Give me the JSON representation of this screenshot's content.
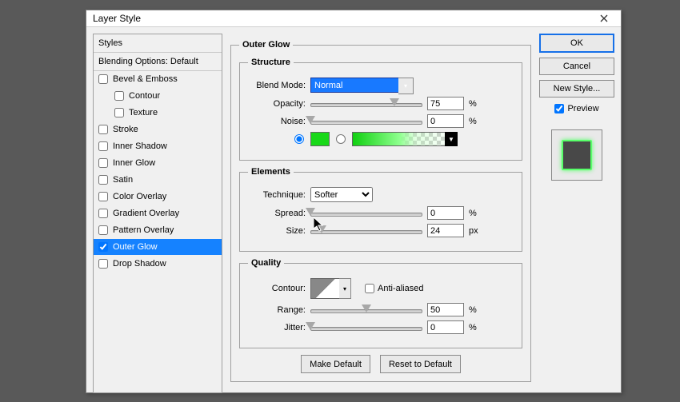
{
  "window": {
    "title": "Layer Style"
  },
  "styles": {
    "header": "Styles",
    "blending": "Blending Options: Default",
    "items": [
      {
        "label": "Bevel & Emboss",
        "indent": false,
        "checked": false,
        "selected": false
      },
      {
        "label": "Contour",
        "indent": true,
        "checked": false,
        "selected": false
      },
      {
        "label": "Texture",
        "indent": true,
        "checked": false,
        "selected": false
      },
      {
        "label": "Stroke",
        "indent": false,
        "checked": false,
        "selected": false
      },
      {
        "label": "Inner Shadow",
        "indent": false,
        "checked": false,
        "selected": false
      },
      {
        "label": "Inner Glow",
        "indent": false,
        "checked": false,
        "selected": false
      },
      {
        "label": "Satin",
        "indent": false,
        "checked": false,
        "selected": false
      },
      {
        "label": "Color Overlay",
        "indent": false,
        "checked": false,
        "selected": false
      },
      {
        "label": "Gradient Overlay",
        "indent": false,
        "checked": false,
        "selected": false
      },
      {
        "label": "Pattern Overlay",
        "indent": false,
        "checked": false,
        "selected": false
      },
      {
        "label": "Outer Glow",
        "indent": false,
        "checked": true,
        "selected": true
      },
      {
        "label": "Drop Shadow",
        "indent": false,
        "checked": false,
        "selected": false
      }
    ]
  },
  "panel": {
    "title": "Outer Glow",
    "structure": {
      "legend": "Structure",
      "blend_label": "Blend Mode:",
      "blend_value": "Normal",
      "opacity_label": "Opacity:",
      "opacity_value": "75",
      "opacity_unit": "%",
      "noise_label": "Noise:",
      "noise_value": "0",
      "noise_unit": "%",
      "color_hex": "#18d818"
    },
    "elements": {
      "legend": "Elements",
      "technique_label": "Technique:",
      "technique_value": "Softer",
      "spread_label": "Spread:",
      "spread_value": "0",
      "spread_unit": "%",
      "size_label": "Size:",
      "size_value": "24",
      "size_unit": "px"
    },
    "quality": {
      "legend": "Quality",
      "contour_label": "Contour:",
      "antialiased_label": "Anti-aliased",
      "range_label": "Range:",
      "range_value": "50",
      "range_unit": "%",
      "jitter_label": "Jitter:",
      "jitter_value": "0",
      "jitter_unit": "%"
    },
    "make_default": "Make Default",
    "reset_default": "Reset to Default"
  },
  "right": {
    "ok": "OK",
    "cancel": "Cancel",
    "new_style": "New Style...",
    "preview": "Preview"
  }
}
